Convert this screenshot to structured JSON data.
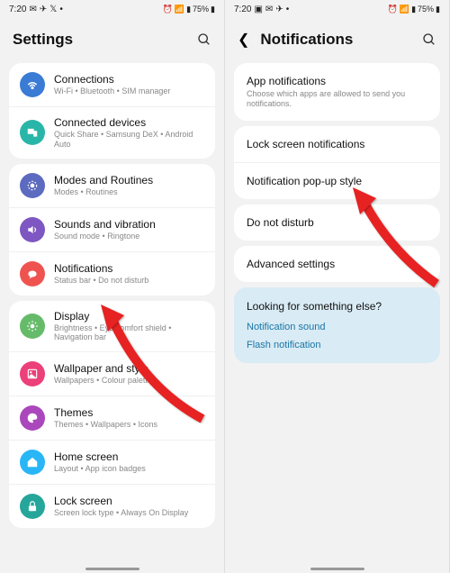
{
  "status": {
    "time": "7:20",
    "battery": "75%"
  },
  "left": {
    "title": "Settings",
    "groups": [
      [
        {
          "title": "Connections",
          "sub": "Wi-Fi • Bluetooth • SIM manager",
          "icon": "wifi",
          "bg": "#3a7bd5"
        },
        {
          "title": "Connected devices",
          "sub": "Quick Share • Samsung DeX • Android Auto",
          "icon": "devices",
          "bg": "#29b6a8"
        }
      ],
      [
        {
          "title": "Modes and Routines",
          "sub": "Modes • Routines",
          "icon": "modes",
          "bg": "#5c6bc0"
        },
        {
          "title": "Sounds and vibration",
          "sub": "Sound mode • Ringtone",
          "icon": "sound",
          "bg": "#7e57c2"
        },
        {
          "title": "Notifications",
          "sub": "Status bar • Do not disturb",
          "icon": "notif",
          "bg": "#ef5350"
        }
      ],
      [
        {
          "title": "Display",
          "sub": "Brightness • Eye comfort shield • Navigation bar",
          "icon": "display",
          "bg": "#66bb6a"
        },
        {
          "title": "Wallpaper and style",
          "sub": "Wallpapers • Colour palette",
          "icon": "wallpaper",
          "bg": "#ec407a"
        },
        {
          "title": "Themes",
          "sub": "Themes • Wallpapers • Icons",
          "icon": "themes",
          "bg": "#ab47bc"
        },
        {
          "title": "Home screen",
          "sub": "Layout • App icon badges",
          "icon": "home",
          "bg": "#29b6f6"
        },
        {
          "title": "Lock screen",
          "sub": "Screen lock type • Always On Display",
          "icon": "lock",
          "bg": "#26a69a"
        }
      ]
    ]
  },
  "right": {
    "title": "Notifications",
    "groups": [
      [
        {
          "title": "App notifications",
          "sub": "Choose which apps are allowed to send you notifications."
        }
      ],
      [
        {
          "title": "Lock screen notifications",
          "sub": ""
        },
        {
          "title": "Notification pop-up style",
          "sub": ""
        }
      ],
      [
        {
          "title": "Do not disturb",
          "sub": ""
        }
      ],
      [
        {
          "title": "Advanced settings",
          "sub": ""
        }
      ]
    ],
    "suggestion": {
      "title": "Looking for something else?",
      "links": [
        "Notification sound",
        "Flash notification"
      ]
    }
  }
}
